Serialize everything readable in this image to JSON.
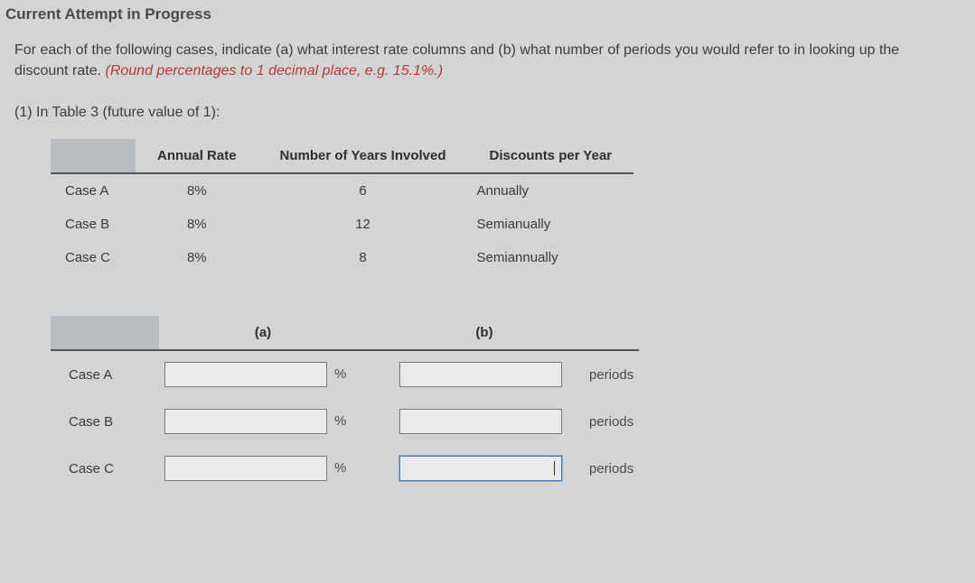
{
  "title": "Current Attempt in Progress",
  "prompt_main": "For each of the following cases, indicate (a) what interest rate columns and (b) what number of periods you would refer to in looking up the discount rate. ",
  "prompt_hint": "(Round percentages to 1 decimal place, e.g. 15.1%.)",
  "subhead": "(1) In Table 3 (future value of 1):",
  "table1": {
    "headers": {
      "rate": "Annual Rate",
      "years": "Number of Years Involved",
      "disc": "Discounts per Year"
    },
    "rows": [
      {
        "label": "Case A",
        "rate": "8%",
        "years": "6",
        "disc": "Annually"
      },
      {
        "label": "Case B",
        "rate": "8%",
        "years": "12",
        "disc": "Semianually"
      },
      {
        "label": "Case C",
        "rate": "8%",
        "years": "8",
        "disc": "Semiannually"
      }
    ]
  },
  "table2": {
    "headers": {
      "a": "(a)",
      "b": "(b)"
    },
    "unit_a": "%",
    "unit_b": "periods",
    "rows": [
      {
        "label": "Case A",
        "a": "",
        "b": ""
      },
      {
        "label": "Case B",
        "a": "",
        "b": ""
      },
      {
        "label": "Case C",
        "a": "",
        "b": ""
      }
    ]
  }
}
